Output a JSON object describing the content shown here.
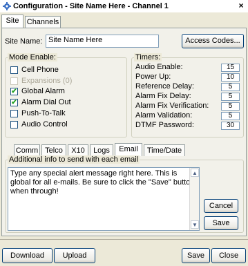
{
  "window": {
    "title": "Configuration - Site Name Here - Channel  1",
    "close_glyph": "×"
  },
  "top_tabs": [
    "Site",
    "Channels"
  ],
  "site": {
    "name_label": "Site Name:",
    "name_value": "Site Name Here",
    "access_codes_button": "Access Codes..."
  },
  "mode_enable": {
    "title": "Mode Enable:",
    "items": [
      {
        "label": "Cell Phone",
        "checked": false,
        "enabled": true
      },
      {
        "label": "Expansions (0)",
        "checked": false,
        "enabled": false
      },
      {
        "label": "Global Alarm",
        "checked": true,
        "enabled": true
      },
      {
        "label": "Alarm Dial Out",
        "checked": true,
        "enabled": true
      },
      {
        "label": "Push-To-Talk",
        "checked": false,
        "enabled": true
      },
      {
        "label": "Audio Control",
        "checked": false,
        "enabled": true
      }
    ]
  },
  "timers": {
    "title": "Timers:",
    "items": [
      {
        "label": "Audio Enable:",
        "value": "15"
      },
      {
        "label": "Power Up:",
        "value": "10"
      },
      {
        "label": "Reference Delay:",
        "value": "5"
      },
      {
        "label": "Alarm Fix Delay:",
        "value": "5"
      },
      {
        "label": "Alarm Fix Verification:",
        "value": "5"
      },
      {
        "label": "Alarm Validation:",
        "value": "5"
      },
      {
        "label": "DTMF Password:",
        "value": "30"
      }
    ]
  },
  "bottom_tabs": [
    "Comm",
    "Telco",
    "X10",
    "Logs",
    "Email",
    "Time/Date"
  ],
  "active_bottom_tab": "Email",
  "email": {
    "group_title": "Additional info to send with each email",
    "message": "Type any special alert message right here.  This is global for all e-mails.  Be sure to click the \"Save\" button when through!",
    "cancel_button": "Cancel",
    "save_button": "Save"
  },
  "footer": {
    "download_button": "Download",
    "upload_button": "Upload",
    "save_button": "Save",
    "close_button": "Close"
  },
  "icons": {
    "app": "gear-icon",
    "close": "close-icon"
  }
}
